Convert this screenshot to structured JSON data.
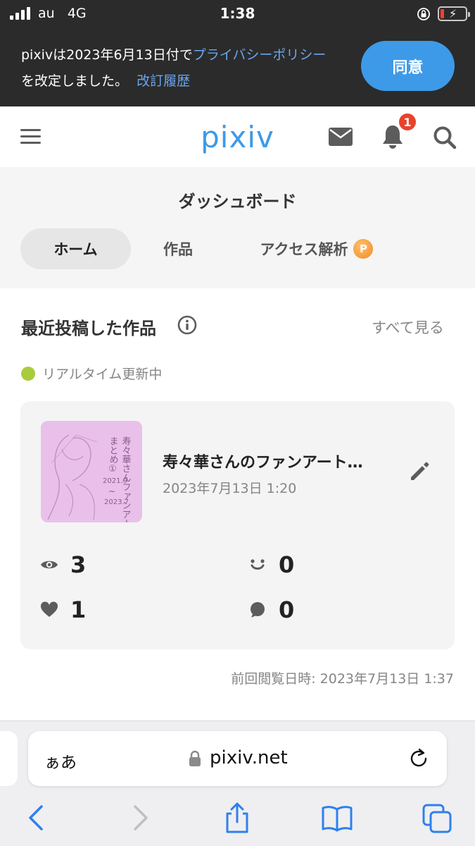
{
  "status_bar": {
    "carrier": "au",
    "network": "4G",
    "time": "1:38"
  },
  "banner": {
    "text_before_link": "pixivは2023年6月13日付で",
    "link_policy": "プライバシーポリシー",
    "text_after_link": "を改定しました。",
    "link_history": "改訂履歴",
    "agree_label": "同意"
  },
  "header": {
    "logo": "pixiv",
    "notification_count": "1"
  },
  "dashboard": {
    "title": "ダッシュボード",
    "tabs": [
      {
        "label": "ホーム",
        "active": true
      },
      {
        "label": "作品",
        "active": false
      },
      {
        "label": "アクセス解析",
        "active": false,
        "premium_badge": "P"
      }
    ]
  },
  "recent": {
    "title": "最近投稿した作品",
    "see_all": "すべて見る",
    "realtime_label": "リアルタイム更新中",
    "work": {
      "title": "寿々華さんのファンアート…",
      "date": "2023年7月13日 1:20",
      "thumbnail_text": [
        "寿々華さんファンアート",
        "まとめ①",
        "2021.9",
        "~",
        "2023.7"
      ],
      "stats": {
        "views": "3",
        "reactions": "0",
        "likes": "1",
        "comments": "0"
      }
    },
    "last_viewed": "前回閲覧日時: 2023年7月13日 1:37"
  },
  "safari": {
    "aa": "ぁあ",
    "url": "pixiv.net"
  },
  "colors": {
    "brand_blue": "#3d9ae8",
    "badge_red": "#e8432b",
    "realtime_green": "#a8cc3c",
    "premium_orange": "#f08a24"
  }
}
